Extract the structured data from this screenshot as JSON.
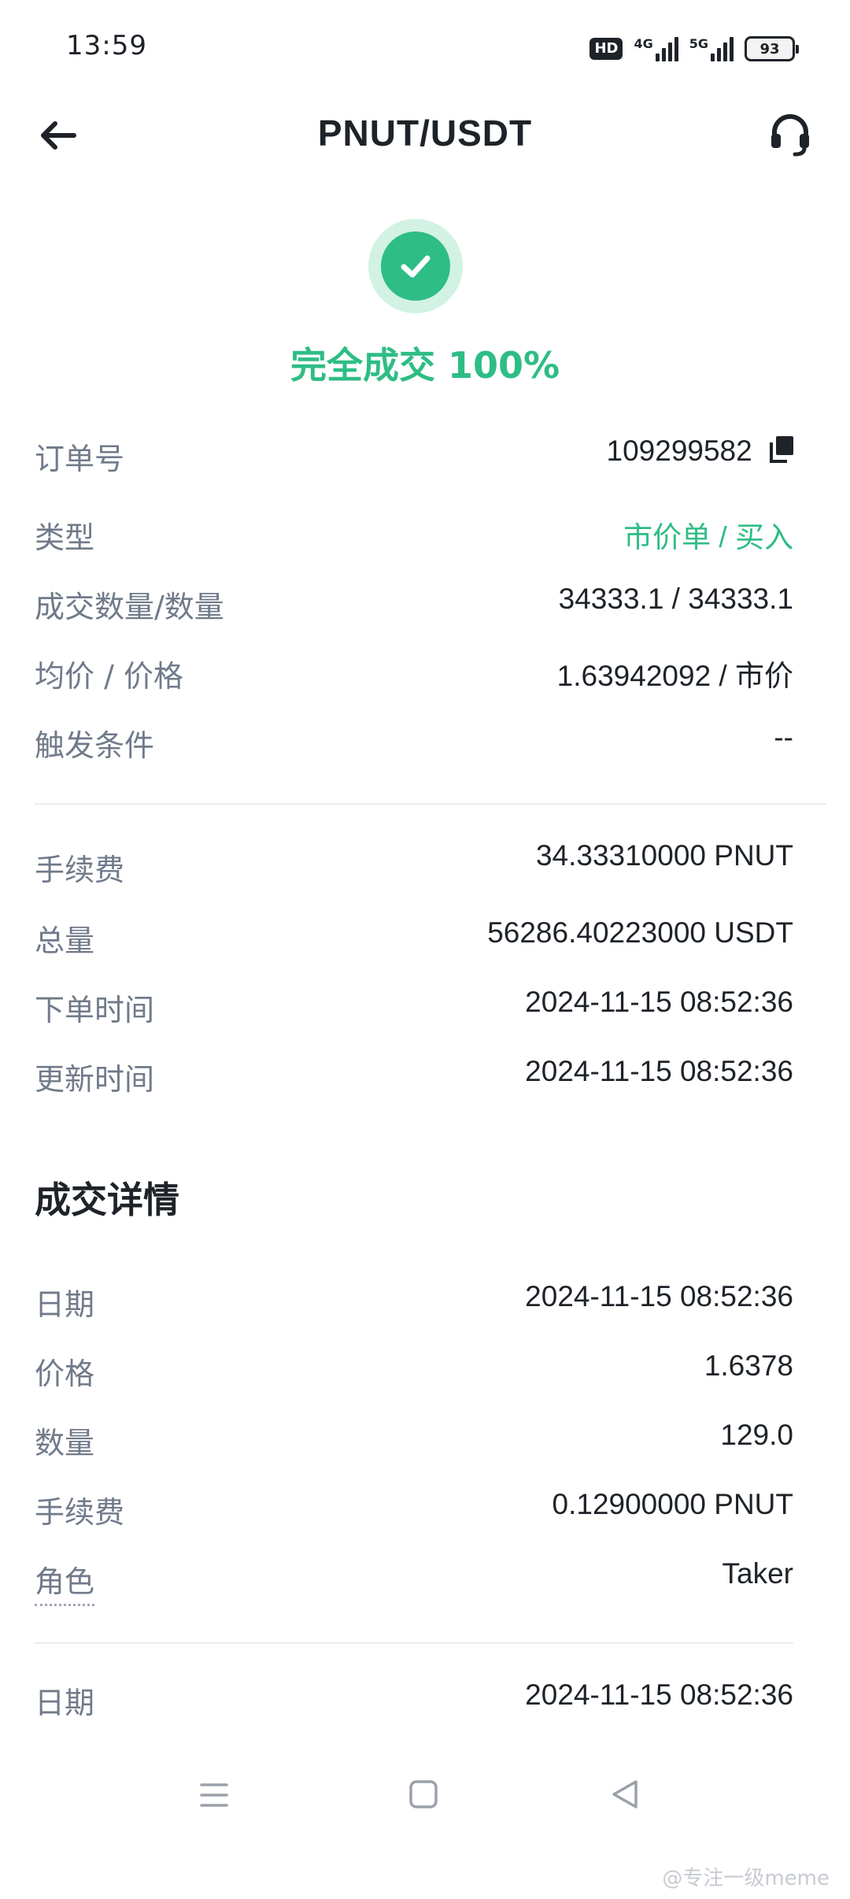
{
  "status_bar": {
    "time": "13:59",
    "hd_label": "HD",
    "network1": "4G",
    "network2": "5G",
    "battery": "93"
  },
  "header": {
    "title": "PNUT/USDT",
    "back_icon": "arrow-left-icon",
    "support_icon": "headset-icon"
  },
  "order_status": {
    "text": "完全成交 100%",
    "icon": "check-circle-icon",
    "color": "#2ebd85"
  },
  "order_info": [
    {
      "label": "订单号",
      "value": "109299582"
    },
    {
      "label": "类型",
      "value": "市价单 / 买入"
    },
    {
      "label": "成交数量/数量",
      "value": "34333.1 / 34333.1"
    },
    {
      "label": "均价 / 价格",
      "value": "1.63942092 / 市价"
    },
    {
      "label": "触发条件",
      "value": "--"
    }
  ],
  "fee_info": [
    {
      "label": "手续费",
      "value": "34.33310000 PNUT"
    },
    {
      "label": "总量",
      "value": "56286.40223000 USDT"
    },
    {
      "label": "下单时间",
      "value": "2024-11-15 08:52:36"
    },
    {
      "label": "更新时间",
      "value": "2024-11-15 08:52:36"
    }
  ],
  "trade_details": {
    "title": "成交详情",
    "items": [
      {
        "date_label": "日期",
        "date": "2024-11-15 08:52:36",
        "price_label": "价格",
        "price": "1.6378",
        "qty_label": "数量",
        "qty": "129.0",
        "fee_label": "手续费",
        "fee": "0.12900000 PNUT",
        "role_label": "角色",
        "role": "Taker"
      },
      {
        "date_label": "日期",
        "date": "2024-11-15 08:52:36"
      }
    ]
  },
  "system_nav": {
    "menu_icon": "menu-icon",
    "home_icon": "home-square-icon",
    "back_icon": "back-triangle-icon"
  },
  "watermark": "@专注一级meme",
  "colors": {
    "accent_green": "#2ebd85",
    "label_gray": "#707a8a",
    "text_dark": "#1e2329",
    "divider": "#eaecef"
  }
}
